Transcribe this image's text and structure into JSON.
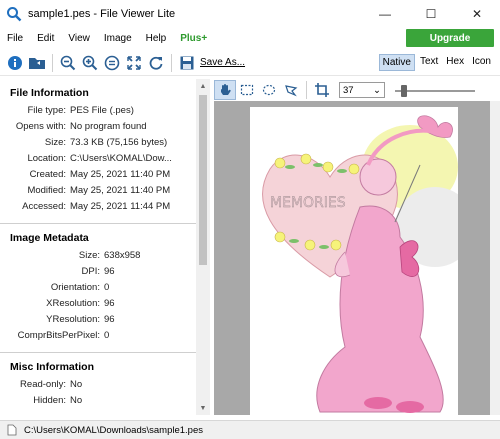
{
  "window": {
    "title": "sample1.pes - File Viewer Lite",
    "app_icon": "magnifier-icon"
  },
  "menu": {
    "items": [
      "File",
      "Edit",
      "View",
      "Image",
      "Help"
    ],
    "plus_label": "Plus+",
    "upgrade_label": "Upgrade"
  },
  "toolbar": {
    "save_label": "Save As...",
    "view_tabs": [
      "Native",
      "Text",
      "Hex",
      "Icon"
    ],
    "active_view": "Native"
  },
  "file_information": {
    "title": "File Information",
    "rows": [
      {
        "key": "File type:",
        "value": "PES File (.pes)"
      },
      {
        "key": "Opens with:",
        "value": "No program found"
      },
      {
        "key": "Size:",
        "value": "73.3 KB (75,156 bytes)"
      },
      {
        "key": "Location:",
        "value": "C:\\Users\\KOMAL\\Dow..."
      },
      {
        "key": "Created:",
        "value": "May 25, 2021 11:40 PM"
      },
      {
        "key": "Modified:",
        "value": "May 25, 2021 11:40 PM"
      },
      {
        "key": "Accessed:",
        "value": "May 25, 2021 11:44 PM"
      }
    ]
  },
  "image_metadata": {
    "title": "Image Metadata",
    "rows": [
      {
        "key": "Size:",
        "value": "638x958"
      },
      {
        "key": "DPI:",
        "value": "96"
      },
      {
        "key": "Orientation:",
        "value": "0"
      },
      {
        "key": "XResolution:",
        "value": "96"
      },
      {
        "key": "YResolution:",
        "value": "96"
      },
      {
        "key": "ComprBitsPerPixel:",
        "value": "0"
      }
    ]
  },
  "misc_information": {
    "title": "Misc Information",
    "rows": [
      {
        "key": "Read-only:",
        "value": "No"
      },
      {
        "key": "Hidden:",
        "value": "No"
      }
    ]
  },
  "image_tools": {
    "zoom_value": "37"
  },
  "statusbar": {
    "path": "C:\\Users\\KOMAL\\Downloads\\sample1.pes"
  },
  "colors": {
    "upgrade_green": "#3aa53a",
    "plus_green": "#2e9a2e",
    "info_blue": "#1f6fbf",
    "active_tab_bg": "#cfe0f3"
  }
}
